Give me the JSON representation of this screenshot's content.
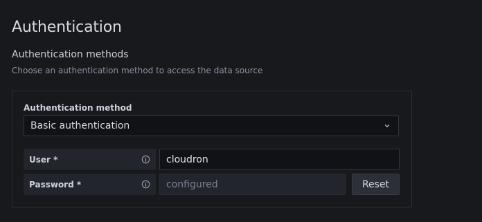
{
  "page": {
    "title": "Authentication",
    "section_title": "Authentication methods",
    "section_description": "Choose an authentication method to access the data source"
  },
  "auth_method": {
    "label": "Authentication method",
    "selected": "Basic authentication",
    "dropdown_icon": "chevron-down-icon"
  },
  "credentials": {
    "user": {
      "label": "User *",
      "value": "cloudron",
      "info_icon": "info-icon"
    },
    "password": {
      "label": "Password *",
      "value": "configured",
      "info_icon": "info-icon"
    },
    "reset_label": "Reset"
  },
  "colors": {
    "background": "#18191d",
    "input_background": "#111217",
    "label_background": "#22252b",
    "border": "#2c2e34"
  }
}
